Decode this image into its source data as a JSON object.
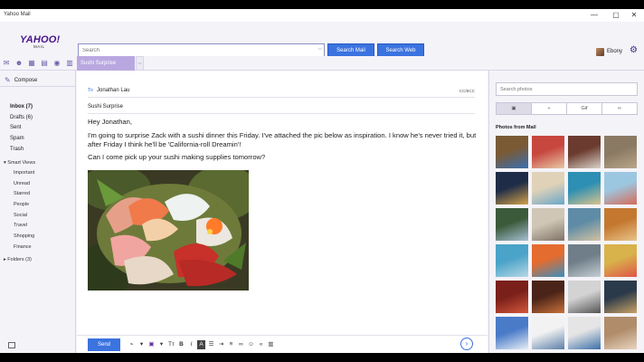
{
  "window": {
    "title": "Yahoo Mail",
    "controls": [
      "—",
      "▢",
      "✕"
    ]
  },
  "logo": {
    "main": "YAHOO!",
    "sub": "MAIL"
  },
  "search": {
    "placeholder": "Search",
    "mail_button": "Search Mail",
    "web_button": "Search Web"
  },
  "user": {
    "name": "Ebony"
  },
  "toolbar": {
    "tab_label": "Sushi Surprise"
  },
  "sidebar": {
    "compose": "Compose",
    "folders": [
      {
        "label": "Inbox (7)",
        "bold": true
      },
      {
        "label": "Drafts (6)",
        "bold": false
      },
      {
        "label": "Sent",
        "bold": false
      },
      {
        "label": "Spam",
        "bold": false
      },
      {
        "label": "Trash",
        "bold": false
      }
    ],
    "smart_views_label": "Smart Views",
    "smart_views": [
      "Important",
      "Unread",
      "Starred",
      "People",
      "Social",
      "Travel",
      "Shopping",
      "Finance"
    ],
    "folders_label": "Folders (3)"
  },
  "compose": {
    "to_label": "To",
    "to_value": "Jonathan Lau",
    "cc_label": "CC/BCC",
    "subject": "Sushi Surprise",
    "body": [
      "Hey Jonathan,",
      "I'm going to surprise Zack with a sushi dinner this Friday. I've attached the pic below as inspiration. I know he's never tried it, but after Friday I think he'll be 'California-roll Dreamin'!",
      "Can I come pick up your sushi making supplies tomorrow?"
    ],
    "send_label": "Send"
  },
  "photos": {
    "search_placeholder": "Search photos",
    "tabs": [
      {
        "icon": "image-icon",
        "glyph": "▣",
        "label": ""
      },
      {
        "icon": "paperclip-icon",
        "glyph": "⌁",
        "label": ""
      },
      {
        "icon": "gif-icon",
        "glyph": "",
        "label": "Gif"
      },
      {
        "icon": "link-icon",
        "glyph": "∞",
        "label": ""
      }
    ],
    "heading": "Photos from Mail",
    "thumb_colors": [
      [
        "#7a5a35",
        "#3a6fb0"
      ],
      [
        "#c7473e",
        "#e8c8a8"
      ],
      [
        "#6a3b2e",
        "#d9d1c9"
      ],
      [
        "#8b7a63",
        "#b9a68a"
      ],
      [
        "#1e2c47",
        "#d4a24a"
      ],
      [
        "#e0d2b8",
        "#6aa6c8"
      ],
      [
        "#2c8fb3",
        "#d8c38c"
      ],
      [
        "#9cc7e0",
        "#d66b58"
      ],
      [
        "#3a5a3a",
        "#a7bfd4"
      ],
      [
        "#cfc6b5",
        "#7f7367"
      ],
      [
        "#5e8ca6",
        "#d3c2a2"
      ],
      [
        "#c4782f",
        "#e8c48a"
      ],
      [
        "#4aa3c8",
        "#b7d8e6"
      ],
      [
        "#e46c2e",
        "#3b8dbe"
      ],
      [
        "#6f7e88",
        "#c6cfd4"
      ],
      [
        "#d8b24a",
        "#e0554a"
      ],
      [
        "#7a1f1a",
        "#d4573c"
      ],
      [
        "#4a2418",
        "#c9713a"
      ],
      [
        "#d3d3d3",
        "#545454"
      ],
      [
        "#2b3a4a",
        "#c9a165"
      ],
      [
        "#4a7bc8",
        "#e8eef6"
      ],
      [
        "#f2f2f2",
        "#5b7fa8"
      ],
      [
        "#e5e5e5",
        "#3b6fa8"
      ],
      [
        "#b08c6a",
        "#e8d5c0"
      ]
    ]
  }
}
